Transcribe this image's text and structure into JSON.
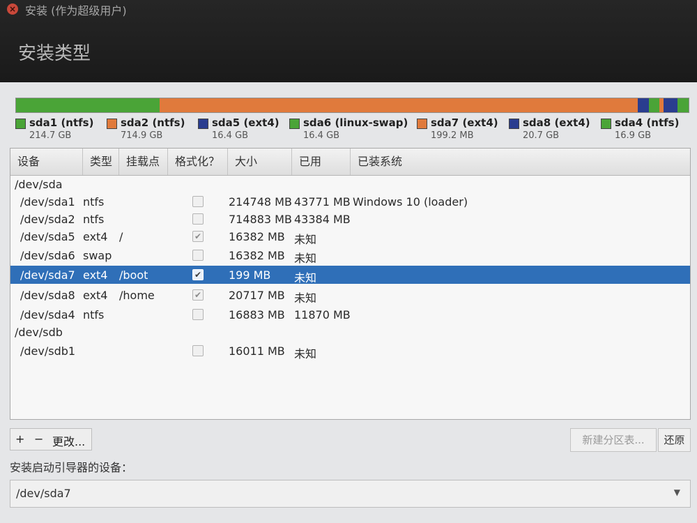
{
  "window": {
    "title": "安装 (作为超级用户)",
    "page_title": "安装类型"
  },
  "partitions_bar": [
    {
      "name": "sda1 (ntfs)",
      "size": "214.7 GB",
      "color": "#4aa437",
      "fraction": 0.176
    },
    {
      "name": "sda2 (ntfs)",
      "size": "714.9 GB",
      "color": "#e07a3c",
      "fraction": 0.587
    },
    {
      "name": "sda5 (ext4)",
      "size": "16.4 GB",
      "color": "#2a3d8f",
      "fraction": 0.013
    },
    {
      "name": "sda6 (linux-swap)",
      "size": "16.4 GB",
      "color": "#4aa437",
      "fraction": 0.013
    },
    {
      "name": "sda7 (ext4)",
      "size": "199.2 MB",
      "color": "#e07a3c",
      "fraction": 0.002
    },
    {
      "name": "sda8 (ext4)",
      "size": "20.7 GB",
      "color": "#2a3d8f",
      "fraction": 0.017
    },
    {
      "name": "sda4 (ntfs)",
      "size": "16.9 GB",
      "color": "#4aa437",
      "fraction": 0.014
    }
  ],
  "table": {
    "headers": [
      "设备",
      "类型",
      "挂载点",
      "格式化？",
      "大小",
      "已用",
      "已装系统"
    ],
    "rows": [
      {
        "device": "/dev/sda",
        "type": "",
        "mount": "",
        "format": null,
        "size": "",
        "used": "",
        "system": ""
      },
      {
        "device": "/dev/sda1",
        "type": "ntfs",
        "mount": "",
        "format": false,
        "size": "214748 MB",
        "used": "43771 MB",
        "system": "Windows 10 (loader)"
      },
      {
        "device": "/dev/sda2",
        "type": "ntfs",
        "mount": "",
        "format": false,
        "size": "714883 MB",
        "used": "43384 MB",
        "system": ""
      },
      {
        "device": "/dev/sda5",
        "type": "ext4",
        "mount": "/",
        "format": true,
        "size": "16382 MB",
        "used": "未知",
        "system": ""
      },
      {
        "device": "/dev/sda6",
        "type": "swap",
        "mount": "",
        "format": false,
        "size": "16382 MB",
        "used": "未知",
        "system": ""
      },
      {
        "device": "/dev/sda7",
        "type": "ext4",
        "mount": "/boot",
        "format": true,
        "size": "199 MB",
        "used": "未知",
        "system": "",
        "selected": true
      },
      {
        "device": "/dev/sda8",
        "type": "ext4",
        "mount": "/home",
        "format": true,
        "size": "20717 MB",
        "used": "未知",
        "system": ""
      },
      {
        "device": "/dev/sda4",
        "type": "ntfs",
        "mount": "",
        "format": false,
        "size": "16883 MB",
        "used": "11870 MB",
        "system": ""
      },
      {
        "device": "/dev/sdb",
        "type": "",
        "mount": "",
        "format": null,
        "size": "",
        "used": "",
        "system": ""
      },
      {
        "device": "/dev/sdb1",
        "type": "",
        "mount": "",
        "format": false,
        "size": "16011 MB",
        "used": "未知",
        "system": ""
      }
    ]
  },
  "buttons": {
    "add": "+",
    "remove": "−",
    "change": "更改...",
    "new_table": "新建分区表...",
    "revert": "还原"
  },
  "boot_loader": {
    "label": "安装启动引导器的设备：",
    "value": "/dev/sda7"
  }
}
